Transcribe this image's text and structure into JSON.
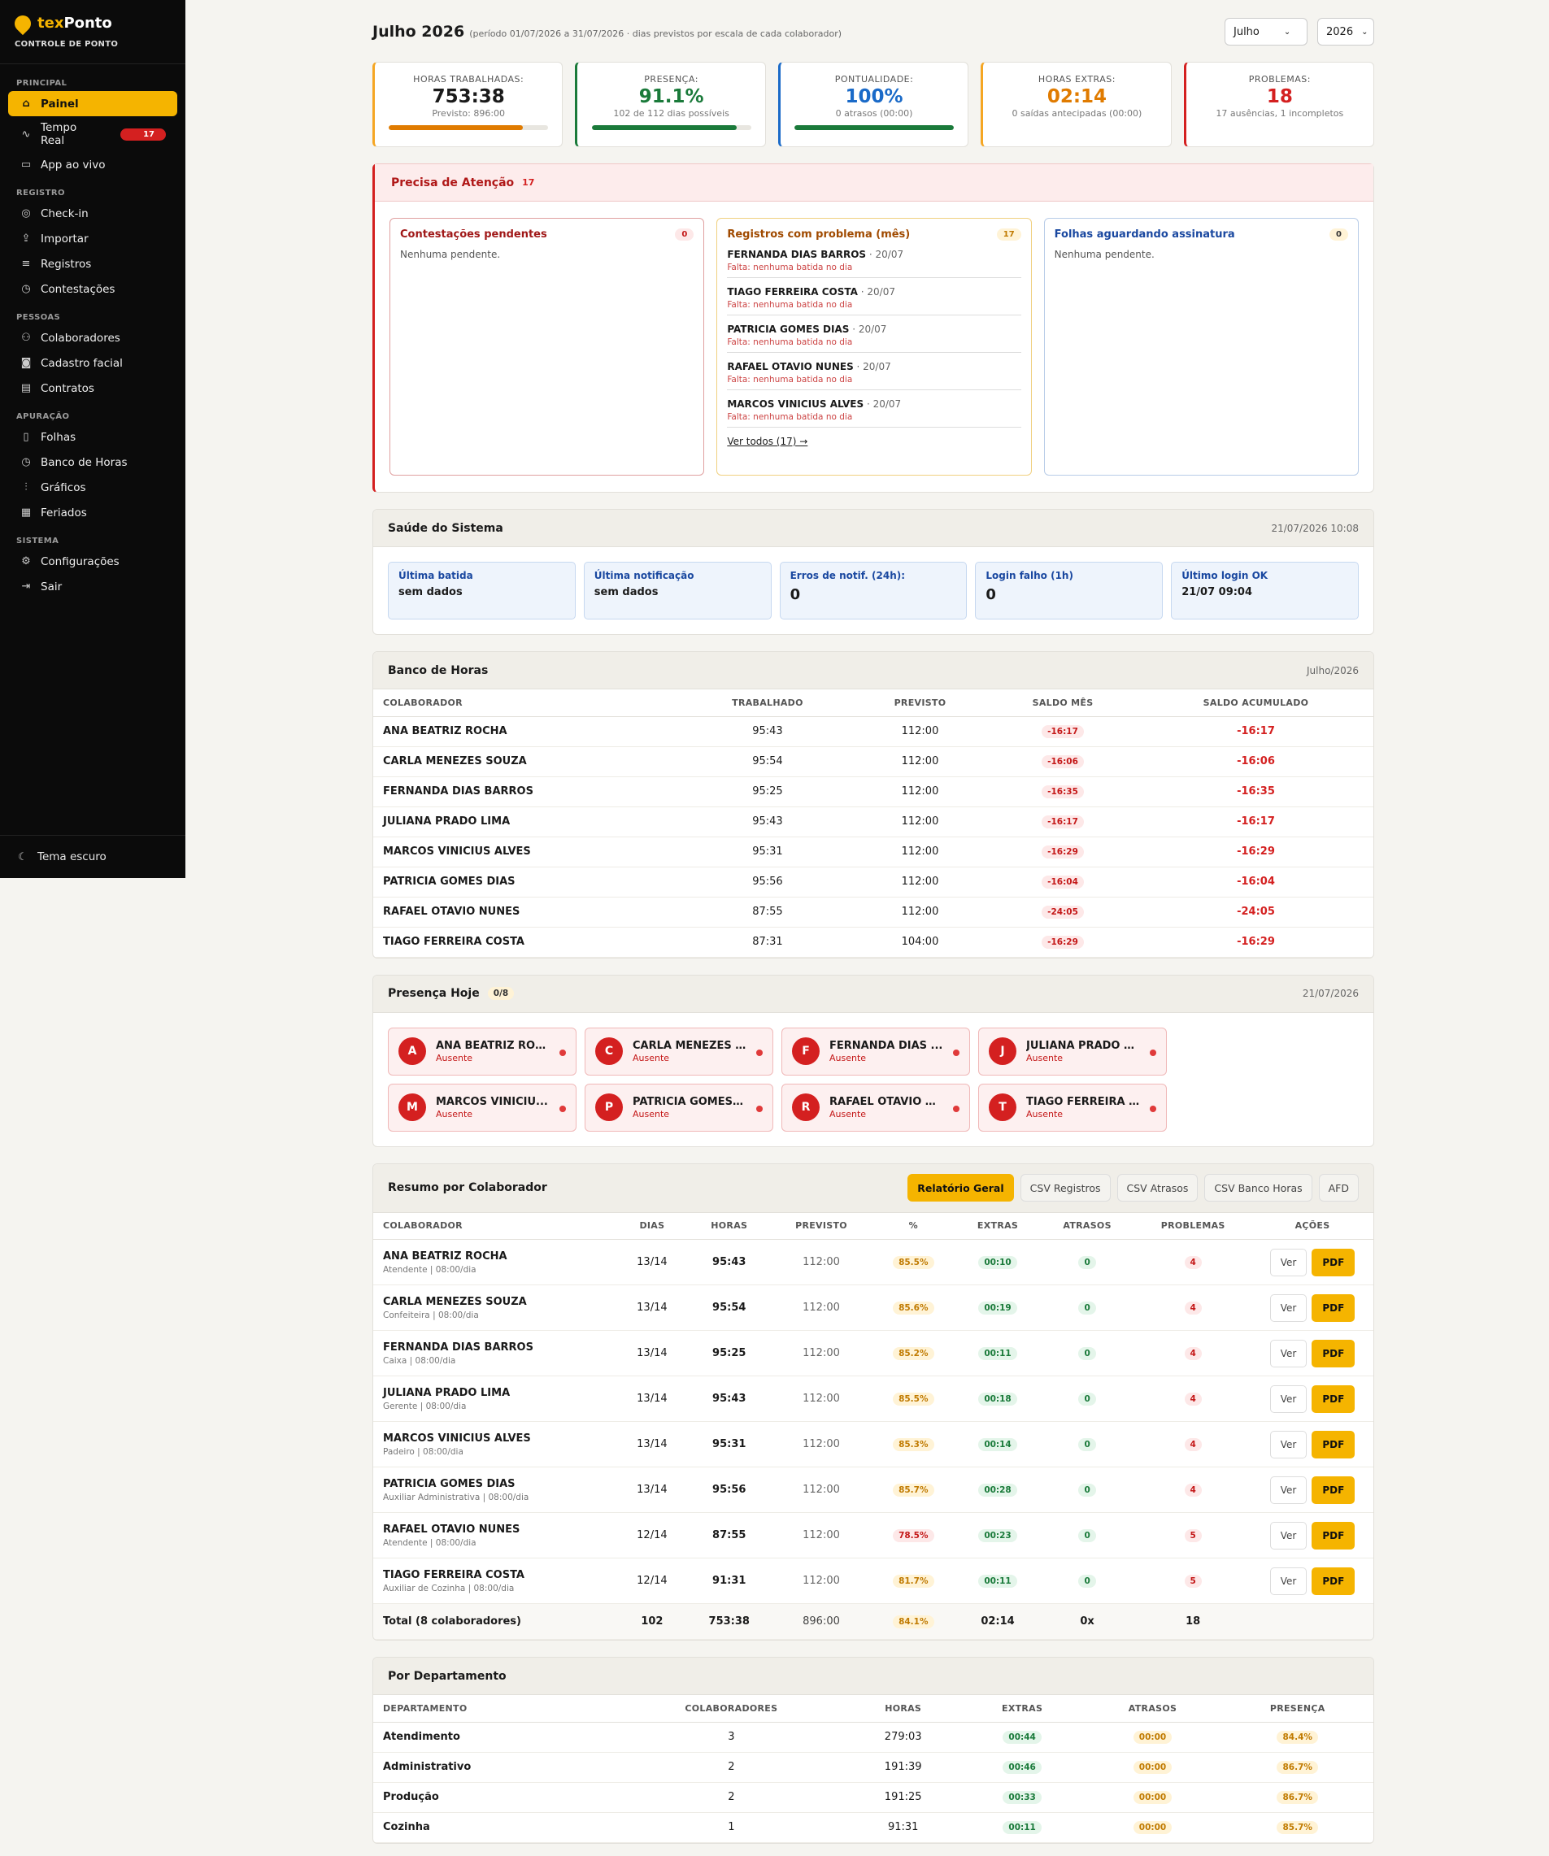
{
  "brand": {
    "name_a": "tex",
    "name_b": "Ponto",
    "subtitle": "CONTROLE DE PONTO"
  },
  "sidebar": {
    "sections": [
      {
        "title": "PRINCIPAL",
        "items": [
          {
            "label": "Painel",
            "icon": "home-icon",
            "active": true
          },
          {
            "label": "Tempo Real",
            "icon": "activity-icon",
            "badge": "17"
          },
          {
            "label": "App ao vivo",
            "icon": "monitor-icon"
          }
        ]
      },
      {
        "title": "REGISTRO",
        "items": [
          {
            "label": "Check-in",
            "icon": "location-icon"
          },
          {
            "label": "Importar",
            "icon": "upload-icon"
          },
          {
            "label": "Registros",
            "icon": "list-icon"
          },
          {
            "label": "Contestações",
            "icon": "clock-icon"
          }
        ]
      },
      {
        "title": "PESSOAS",
        "items": [
          {
            "label": "Colaboradores",
            "icon": "users-icon"
          },
          {
            "label": "Cadastro facial",
            "icon": "camera-icon"
          },
          {
            "label": "Contratos",
            "icon": "document-icon"
          }
        ]
      },
      {
        "title": "APURAÇÃO",
        "items": [
          {
            "label": "Folhas",
            "icon": "file-icon"
          },
          {
            "label": "Banco de Horas",
            "icon": "clock-icon"
          },
          {
            "label": "Gráficos",
            "icon": "chart-icon"
          },
          {
            "label": "Feriados",
            "icon": "calendar-icon"
          }
        ]
      },
      {
        "title": "SISTEMA",
        "items": [
          {
            "label": "Configurações",
            "icon": "gear-icon"
          },
          {
            "label": "Sair",
            "icon": "logout-icon"
          }
        ]
      }
    ],
    "theme_label": "Tema escuro"
  },
  "header": {
    "title": "Julho 2026",
    "subtitle": "(período 01/07/2026 a 31/07/2026 · dias previstos por escala de cada colaborador)",
    "month": "Julho",
    "year": "2026"
  },
  "kpis": [
    {
      "label": "HORAS TRABALHADAS:",
      "value": "753:38",
      "sub": "Previsto: 896:00",
      "color": "#1a1a1a",
      "border": "#f5a623",
      "bar": 0.84,
      "bar_color": "#e07b00"
    },
    {
      "label": "PRESENÇA:",
      "value": "91.1%",
      "sub": "102 de 112 dias possíveis",
      "color": "#1a7a3a",
      "border": "#1a7a3a",
      "bar": 0.91,
      "bar_color": "#1a7a3a"
    },
    {
      "label": "PONTUALIDADE:",
      "value": "100%",
      "sub": "0 atrasos (00:00)",
      "color": "#1a6ac8",
      "border": "#1a6ac8",
      "bar": 1.0,
      "bar_color": "#1a7a3a"
    },
    {
      "label": "HORAS EXTRAS:",
      "value": "02:14",
      "sub": "0 saídas antecipadas (00:00)",
      "color": "#e07b00",
      "border": "#f5a623"
    },
    {
      "label": "PROBLEMAS:",
      "value": "18",
      "sub": "17 ausências, 1 incompletos",
      "color": "#d42020",
      "border": "#d42020"
    }
  ],
  "attention": {
    "title": "Precisa de Atenção",
    "count": "17",
    "contest": {
      "title": "Contestações pendentes",
      "count": "0",
      "empty": "Nenhuma pendente."
    },
    "problems": {
      "title": "Registros com problema (mês)",
      "count": "17",
      "items": [
        {
          "name": "FERNANDA DIAS BARROS",
          "date": " · 20/07",
          "desc": "Falta: nenhuma batida no dia"
        },
        {
          "name": "TIAGO FERREIRA COSTA",
          "date": " · 20/07",
          "desc": "Falta: nenhuma batida no dia"
        },
        {
          "name": "PATRICIA GOMES DIAS",
          "date": " · 20/07",
          "desc": "Falta: nenhuma batida no dia"
        },
        {
          "name": "RAFAEL OTAVIO NUNES",
          "date": " · 20/07",
          "desc": "Falta: nenhuma batida no dia"
        },
        {
          "name": "MARCOS VINICIUS ALVES",
          "date": " · 20/07",
          "desc": "Falta: nenhuma batida no dia"
        }
      ],
      "link": "Ver todos (17) →"
    },
    "sign": {
      "title": "Folhas aguardando assinatura",
      "count": "0",
      "empty": "Nenhuma pendente."
    }
  },
  "health": {
    "title": "Saúde do Sistema",
    "timestamp": "21/07/2026 10:08",
    "boxes": [
      {
        "label": "Última batida",
        "value": "sem dados",
        "big": false
      },
      {
        "label": "Última notificação",
        "value": "sem dados",
        "big": false
      },
      {
        "label": "Erros de notif. (24h):",
        "value": "0",
        "big": true
      },
      {
        "label": "Login falho (1h)",
        "value": "0",
        "big": true
      },
      {
        "label": "Último login OK",
        "value": "21/07 09:04",
        "big": false
      }
    ]
  },
  "bank": {
    "title": "Banco de Horas",
    "period": "Julho/2026",
    "headers": [
      "COLABORADOR",
      "TRABALHADO",
      "PREVISTO",
      "SALDO MÊS",
      "SALDO ACUMULADO"
    ],
    "rows": [
      [
        "ANA BEATRIZ ROCHA",
        "95:43",
        "112:00",
        "-16:17",
        "-16:17"
      ],
      [
        "CARLA MENEZES SOUZA",
        "95:54",
        "112:00",
        "-16:06",
        "-16:06"
      ],
      [
        "FERNANDA DIAS BARROS",
        "95:25",
        "112:00",
        "-16:35",
        "-16:35"
      ],
      [
        "JULIANA PRADO LIMA",
        "95:43",
        "112:00",
        "-16:17",
        "-16:17"
      ],
      [
        "MARCOS VINICIUS ALVES",
        "95:31",
        "112:00",
        "-16:29",
        "-16:29"
      ],
      [
        "PATRICIA GOMES DIAS",
        "95:56",
        "112:00",
        "-16:04",
        "-16:04"
      ],
      [
        "RAFAEL OTAVIO NUNES",
        "87:55",
        "112:00",
        "-24:05",
        "-24:05"
      ],
      [
        "TIAGO FERREIRA COSTA",
        "87:31",
        "104:00",
        "-16:29",
        "-16:29"
      ]
    ]
  },
  "presence": {
    "title": "Presença Hoje",
    "count": "0/8",
    "date": "21/07/2026",
    "people": [
      {
        "initial": "A",
        "name": "ANA BEATRIZ ROC...",
        "status": "Ausente"
      },
      {
        "initial": "C",
        "name": "CARLA MENEZES ...",
        "status": "Ausente"
      },
      {
        "initial": "F",
        "name": "FERNANDA DIAS ...",
        "status": "Ausente"
      },
      {
        "initial": "J",
        "name": "JULIANA PRADO L...",
        "status": "Ausente"
      },
      {
        "initial": "M",
        "name": "MARCOS VINICIU...",
        "status": "Ausente"
      },
      {
        "initial": "P",
        "name": "PATRICIA GOMES ...",
        "status": "Ausente"
      },
      {
        "initial": "R",
        "name": "RAFAEL OTAVIO N...",
        "status": "Ausente"
      },
      {
        "initial": "T",
        "name": "TIAGO FERREIRA ...",
        "status": "Ausente"
      }
    ]
  },
  "summary": {
    "title": "Resumo por Colaborador",
    "buttons": [
      "Relatório Geral",
      "CSV Registros",
      "CSV Atrasos",
      "CSV Banco Horas",
      "AFD"
    ],
    "headers": [
      "COLABORADOR",
      "DIAS",
      "HORAS",
      "PREVISTO",
      "%",
      "EXTRAS",
      "ATRASOS",
      "PROBLEMAS",
      "AÇÕES"
    ],
    "view_label": "Ver",
    "pdf_label": "PDF",
    "rows": [
      {
        "name": "ANA BEATRIZ ROCHA",
        "role": "Atendente | 08:00/dia",
        "dias": "13/14",
        "horas": "95:43",
        "prev": "112:00",
        "pct": "85.5%",
        "extras": "00:10",
        "atrasos": "0",
        "problemas": "4"
      },
      {
        "name": "CARLA MENEZES SOUZA",
        "role": "Confeiteira | 08:00/dia",
        "dias": "13/14",
        "horas": "95:54",
        "prev": "112:00",
        "pct": "85.6%",
        "extras": "00:19",
        "atrasos": "0",
        "problemas": "4"
      },
      {
        "name": "FERNANDA DIAS BARROS",
        "role": "Caixa | 08:00/dia",
        "dias": "13/14",
        "horas": "95:25",
        "prev": "112:00",
        "pct": "85.2%",
        "extras": "00:11",
        "atrasos": "0",
        "problemas": "4"
      },
      {
        "name": "JULIANA PRADO LIMA",
        "role": "Gerente | 08:00/dia",
        "dias": "13/14",
        "horas": "95:43",
        "prev": "112:00",
        "pct": "85.5%",
        "extras": "00:18",
        "atrasos": "0",
        "problemas": "4"
      },
      {
        "name": "MARCOS VINICIUS ALVES",
        "role": "Padeiro | 08:00/dia",
        "dias": "13/14",
        "horas": "95:31",
        "prev": "112:00",
        "pct": "85.3%",
        "extras": "00:14",
        "atrasos": "0",
        "problemas": "4"
      },
      {
        "name": "PATRICIA GOMES DIAS",
        "role": "Auxiliar Administrativa | 08:00/dia",
        "dias": "13/14",
        "horas": "95:56",
        "prev": "112:00",
        "pct": "85.7%",
        "extras": "00:28",
        "atrasos": "0",
        "problemas": "4"
      },
      {
        "name": "RAFAEL OTAVIO NUNES",
        "role": "Atendente | 08:00/dia",
        "dias": "12/14",
        "horas": "87:55",
        "prev": "112:00",
        "pct": "78.5%",
        "extras": "00:23",
        "atrasos": "0",
        "problemas": "5",
        "pct_bad": true
      },
      {
        "name": "TIAGO FERREIRA COSTA",
        "role": "Auxiliar de Cozinha | 08:00/dia",
        "dias": "12/14",
        "horas": "91:31",
        "prev": "112:00",
        "pct": "81.7%",
        "extras": "00:11",
        "atrasos": "0",
        "problemas": "5"
      }
    ],
    "total": {
      "label": "Total (8 colaboradores)",
      "dias": "102",
      "horas": "753:38",
      "prev": "896:00",
      "pct": "84.1%",
      "extras": "02:14",
      "atrasos": "0x",
      "problemas": "18"
    }
  },
  "departments": {
    "title": "Por Departamento",
    "headers": [
      "DEPARTAMENTO",
      "COLABORADORES",
      "HORAS",
      "EXTRAS",
      "ATRASOS",
      "PRESENÇA"
    ],
    "rows": [
      [
        "Atendimento",
        "3",
        "279:03",
        "00:44",
        "00:00",
        "84.4%"
      ],
      [
        "Administrativo",
        "2",
        "191:39",
        "00:46",
        "00:00",
        "86.7%"
      ],
      [
        "Produção",
        "2",
        "191:25",
        "00:33",
        "00:00",
        "86.7%"
      ],
      [
        "Cozinha",
        "1",
        "91:31",
        "00:11",
        "00:00",
        "85.7%"
      ]
    ]
  }
}
